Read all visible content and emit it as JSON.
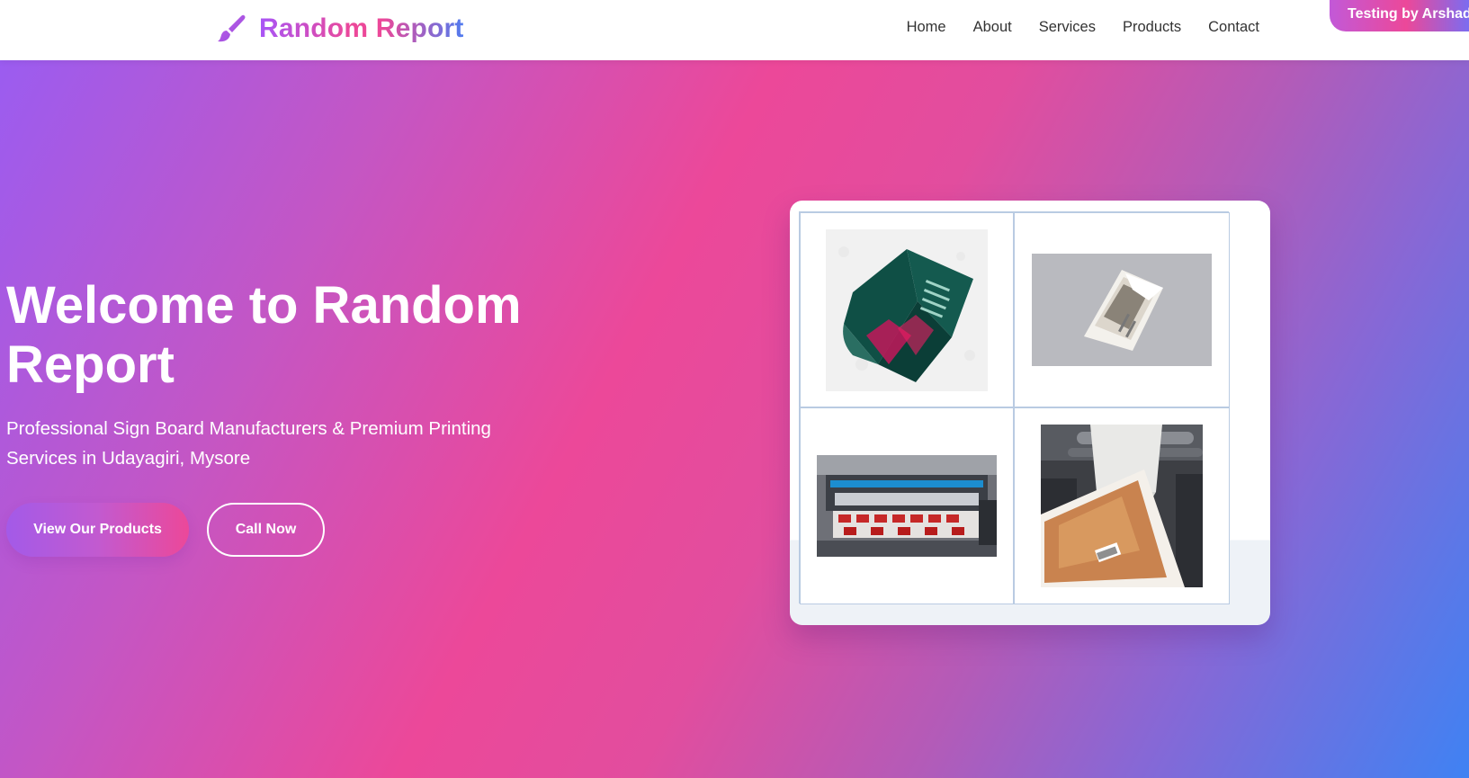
{
  "header": {
    "logo_text": "Random Report",
    "logo_icon": "paint-brush-icon",
    "nav": [
      "Home",
      "About",
      "Services",
      "Products",
      "Contact"
    ],
    "badge": "Testing by Arshad"
  },
  "hero": {
    "title": "Welcome to Random Report",
    "subtitle": "Professional Sign Board Manufacturers & Premium Printing Services in Udayagiri, Mysore",
    "primary_button": "View Our Products",
    "secondary_button": "Call Now"
  },
  "colors": {
    "brand_purple": "#a855f7",
    "brand_pink": "#ec4899",
    "brand_blue": "#3f82f3"
  }
}
